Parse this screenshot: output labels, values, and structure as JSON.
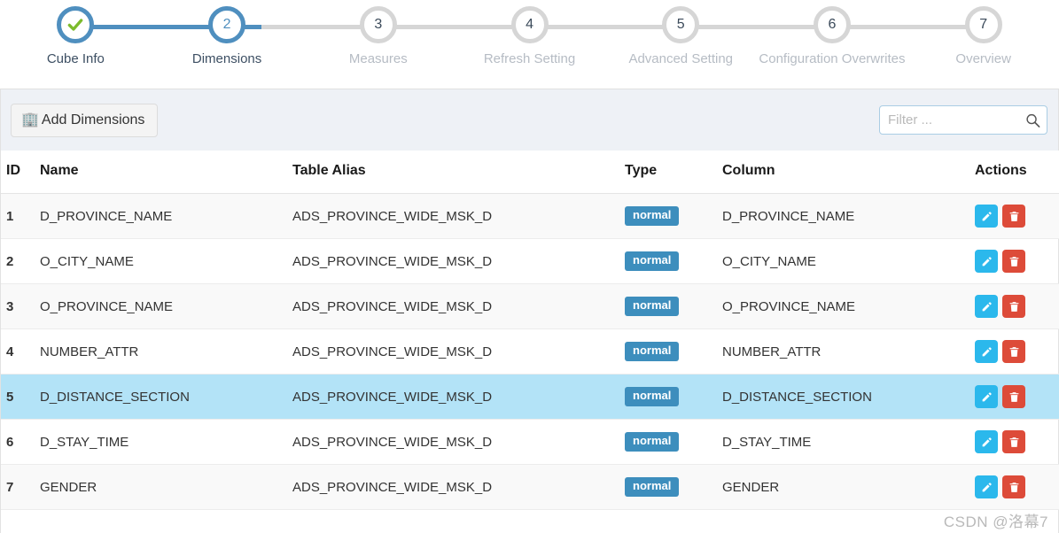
{
  "wizard": {
    "steps": [
      {
        "num": "1",
        "label": "Cube Info",
        "state": "complete",
        "icon": "check-icon"
      },
      {
        "num": "2",
        "label": "Dimensions",
        "state": "active",
        "icon": ""
      },
      {
        "num": "3",
        "label": "Measures",
        "state": "pending",
        "icon": ""
      },
      {
        "num": "4",
        "label": "Refresh Setting",
        "state": "pending",
        "icon": ""
      },
      {
        "num": "5",
        "label": "Advanced Setting",
        "state": "pending",
        "icon": ""
      },
      {
        "num": "6",
        "label": "Configuration Overwrites",
        "state": "pending",
        "icon": ""
      },
      {
        "num": "7",
        "label": "Overview",
        "state": "pending",
        "icon": ""
      }
    ]
  },
  "toolbar": {
    "add_label": "Add Dimensions",
    "add_icon": "🏢",
    "filter_placeholder": "Filter ...",
    "filter_value": "",
    "search_icon": "search-icon"
  },
  "table": {
    "headers": {
      "id": "ID",
      "name": "Name",
      "alias": "Table Alias",
      "type": "Type",
      "column": "Column",
      "actions": "Actions"
    },
    "rows": [
      {
        "id": "1",
        "name": "D_PROVINCE_NAME",
        "alias": "ADS_PROVINCE_WIDE_MSK_D",
        "type": "normal",
        "column": "D_PROVINCE_NAME",
        "selected": false
      },
      {
        "id": "2",
        "name": "O_CITY_NAME",
        "alias": "ADS_PROVINCE_WIDE_MSK_D",
        "type": "normal",
        "column": "O_CITY_NAME",
        "selected": false
      },
      {
        "id": "3",
        "name": "O_PROVINCE_NAME",
        "alias": "ADS_PROVINCE_WIDE_MSK_D",
        "type": "normal",
        "column": "O_PROVINCE_NAME",
        "selected": false
      },
      {
        "id": "4",
        "name": "NUMBER_ATTR",
        "alias": "ADS_PROVINCE_WIDE_MSK_D",
        "type": "normal",
        "column": "NUMBER_ATTR",
        "selected": false
      },
      {
        "id": "5",
        "name": "D_DISTANCE_SECTION",
        "alias": "ADS_PROVINCE_WIDE_MSK_D",
        "type": "normal",
        "column": "D_DISTANCE_SECTION",
        "selected": true
      },
      {
        "id": "6",
        "name": "D_STAY_TIME",
        "alias": "ADS_PROVINCE_WIDE_MSK_D",
        "type": "normal",
        "column": "D_STAY_TIME",
        "selected": false
      },
      {
        "id": "7",
        "name": "GENDER",
        "alias": "ADS_PROVINCE_WIDE_MSK_D",
        "type": "normal",
        "column": "GENDER",
        "selected": false
      }
    ],
    "edit_icon": "pencil-icon",
    "delete_icon": "trash-icon"
  },
  "watermark": "CSDN @洛幕7",
  "colors": {
    "accent_blue": "#4f8fbf",
    "badge_blue": "#3d8ebd",
    "edit_cyan": "#2bb8ec",
    "delete_red": "#dd4b39",
    "selected_row": "#b3e3f7",
    "toolbar_bg": "#eef1f6",
    "step_pending": "#d6d6d6"
  }
}
